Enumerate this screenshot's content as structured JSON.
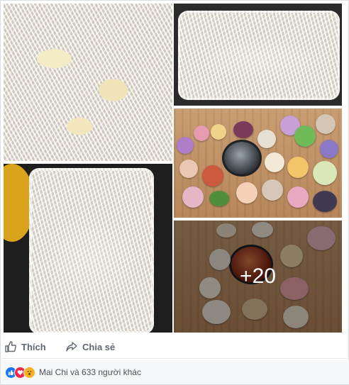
{
  "post": {
    "photo_count_overlay": "+20",
    "photos": [
      {
        "name": "photo-noodles-closeup",
        "icon": "food-photo"
      },
      {
        "name": "photo-container-top",
        "icon": "food-photo"
      },
      {
        "name": "photo-container-left",
        "icon": "food-photo"
      },
      {
        "name": "photo-hotpot-spread",
        "icon": "food-photo"
      },
      {
        "name": "photo-hotpot-more",
        "icon": "food-photo"
      }
    ]
  },
  "actions": {
    "like_label": "Thích",
    "share_label": "Chia sẻ",
    "like_icon": "thumbs-up-icon",
    "share_icon": "share-arrow-icon"
  },
  "reactions": {
    "summary": "Mai Chi và 633 người khác",
    "icons": [
      "like-reaction-icon",
      "love-reaction-icon",
      "wow-reaction-icon"
    ],
    "colors": {
      "like": "#1877f2",
      "love": "#f0284a",
      "wow": "#f7b125"
    }
  }
}
